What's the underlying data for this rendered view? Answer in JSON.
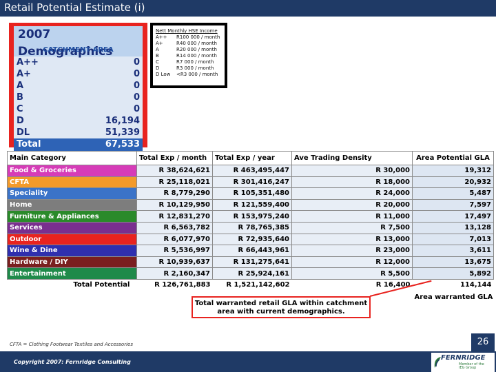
{
  "header": {
    "title": "Retail Potential Estimate (i)"
  },
  "demographics": {
    "title": "2007 Demographics",
    "subtitle": "CATCHMENT AREA",
    "rows": [
      {
        "group": "A++",
        "value": "0"
      },
      {
        "group": "A+",
        "value": "0"
      },
      {
        "group": "A",
        "value": "0"
      },
      {
        "group": "B",
        "value": "0"
      },
      {
        "group": "C",
        "value": "0"
      },
      {
        "group": "D",
        "value": "16,194"
      },
      {
        "group": "DL",
        "value": "51,339"
      }
    ],
    "total_label": "Total",
    "total_value": "67,533"
  },
  "income": {
    "title": "Nett Monthly HSE Income",
    "rows": [
      {
        "group": "A++",
        "range": "R100 000 / month"
      },
      {
        "group": "A+",
        "range": "R40 000 / month"
      },
      {
        "group": "A",
        "range": "R20 000 / month"
      },
      {
        "group": "B",
        "range": "R14 000 / month"
      },
      {
        "group": "C",
        "range": "R7 000 / month"
      },
      {
        "group": "D",
        "range": "R3 000 / month"
      },
      {
        "group": "D Low",
        "range": "<R3 000 / month"
      }
    ]
  },
  "table": {
    "headers": [
      "Main Category",
      "Total Exp / month",
      "Total Exp / year",
      "Ave Trading Density",
      "Area Potential GLA"
    ],
    "rows": [
      {
        "category": "Food & Groceries",
        "color": "#d63cb8",
        "month": "R 38,624,621",
        "year": "R 463,495,447",
        "density": "R 30,000",
        "gla": "19,312"
      },
      {
        "category": "CFTA",
        "color": "#f39a2a",
        "month": "R 25,118,021",
        "year": "R 301,416,247",
        "density": "R 18,000",
        "gla": "20,932"
      },
      {
        "category": "Speciality",
        "color": "#3b73c8",
        "month": "R 8,779,290",
        "year": "R 105,351,480",
        "density": "R 24,000",
        "gla": "5,487"
      },
      {
        "category": "Home",
        "color": "#7d7d7d",
        "month": "R 10,129,950",
        "year": "R 121,559,400",
        "density": "R 20,000",
        "gla": "7,597"
      },
      {
        "category": "Furniture & Appliances",
        "color": "#2a8a2a",
        "month": "R 12,831,270",
        "year": "R 153,975,240",
        "density": "R 11,000",
        "gla": "17,497"
      },
      {
        "category": "Services",
        "color": "#7a2f8f",
        "month": "R 6,563,782",
        "year": "R 78,765,385",
        "density": "R 7,500",
        "gla": "13,128"
      },
      {
        "category": "Outdoor",
        "color": "#e8231f",
        "month": "R 6,077,970",
        "year": "R 72,935,640",
        "density": "R 13,000",
        "gla": "7,013"
      },
      {
        "category": "Wine & Dine",
        "color": "#2f2fae",
        "month": "R 5,536,997",
        "year": "R 66,443,961",
        "density": "R 23,000",
        "gla": "3,611"
      },
      {
        "category": "Hardware / DIY",
        "color": "#7a1f1f",
        "month": "R 10,939,637",
        "year": "R 131,275,641",
        "density": "R 12,000",
        "gla": "13,675"
      },
      {
        "category": "Entertainment",
        "color": "#1f8a4a",
        "month": "R 2,160,347",
        "year": "R 25,924,161",
        "density": "R 5,500",
        "gla": "5,892"
      }
    ],
    "total_label": "Total Potential",
    "total_month": "R 126,761,883",
    "total_year": "R 1,521,142,602",
    "total_density": "R 16,400",
    "total_gla": "114,144",
    "warranted_label": "Area warranted GLA"
  },
  "callout": {
    "text": "Total warranted retail GLA within catchment area with current demographics."
  },
  "footnote": "CFTA = Clothing Footwear Textiles and Accessories",
  "footer": {
    "copyright": "Copyright 2007: Fernridge Consulting",
    "page_number": "26",
    "logo_text": "FERNRIDGE",
    "logo_sub_1": "Member of the",
    "logo_sub_2": "IEG Group"
  }
}
